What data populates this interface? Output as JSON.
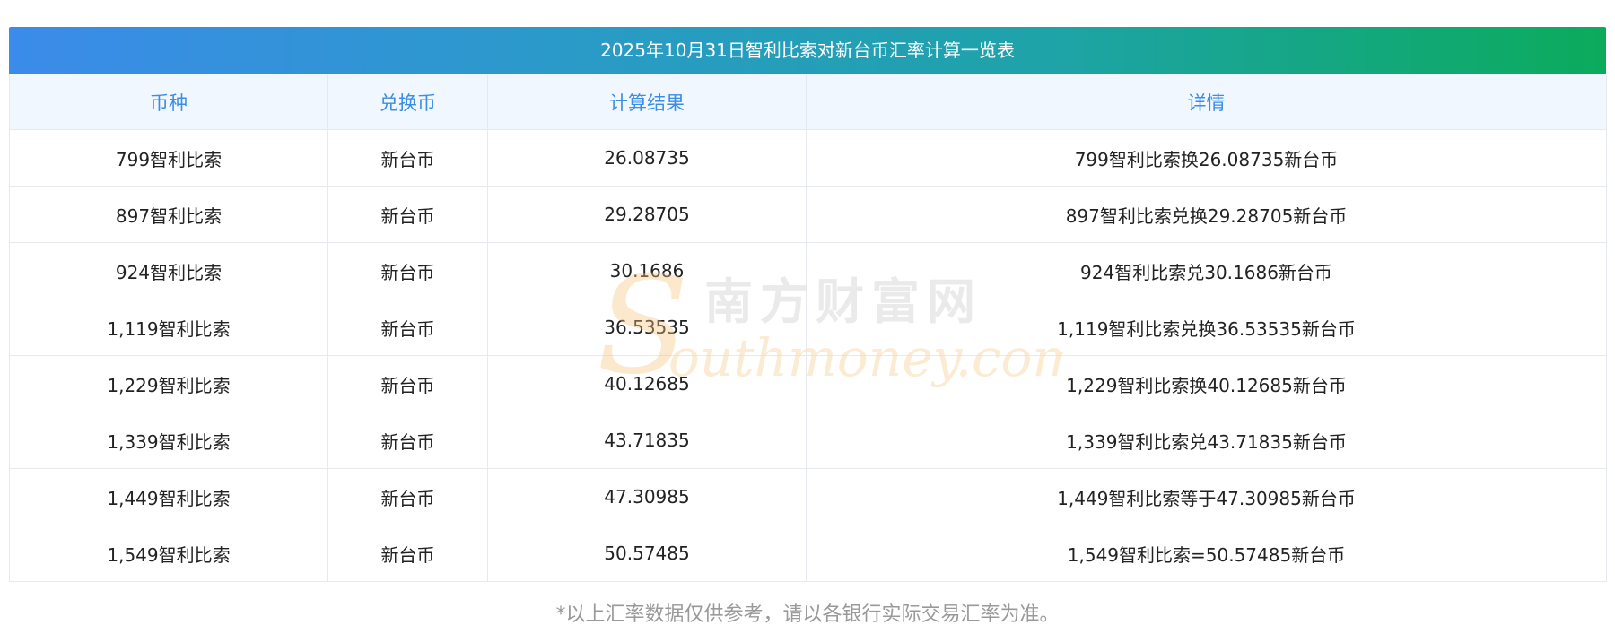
{
  "title": "2025年10月31日智利比索对新台币汇率计算一览表",
  "columns": [
    "币种",
    "兑换币",
    "计算结果",
    "详情"
  ],
  "rows": [
    {
      "currency": "799智利比索",
      "target": "新台币",
      "result": "26.08735",
      "detail": "799智利比索换26.08735新台币"
    },
    {
      "currency": "897智利比索",
      "target": "新台币",
      "result": "29.28705",
      "detail": "897智利比索兑换29.28705新台币"
    },
    {
      "currency": "924智利比索",
      "target": "新台币",
      "result": "30.1686",
      "detail": "924智利比索兑30.1686新台币"
    },
    {
      "currency": "1,119智利比索",
      "target": "新台币",
      "result": "36.53535",
      "detail": "1,119智利比索兑换36.53535新台币"
    },
    {
      "currency": "1,229智利比索",
      "target": "新台币",
      "result": "40.12685",
      "detail": "1,229智利比索换40.12685新台币"
    },
    {
      "currency": "1,339智利比索",
      "target": "新台币",
      "result": "43.71835",
      "detail": "1,339智利比索兑43.71835新台币"
    },
    {
      "currency": "1,449智利比索",
      "target": "新台币",
      "result": "47.30985",
      "detail": "1,449智利比索等于47.30985新台币"
    },
    {
      "currency": "1,549智利比索",
      "target": "新台币",
      "result": "50.57485",
      "detail": "1,549智利比索=50.57485新台币"
    }
  ],
  "watermark": {
    "cn": "南方财富网",
    "en": "outhmoney.com",
    "s": "S"
  },
  "footnote": "*以上汇率数据仅供参考，请以各银行实际交易汇率为准。",
  "colors": {
    "header_text": "#3a8ee6",
    "header_bg": "#f1f7fe",
    "gradient_start": "#3b8bea",
    "gradient_end": "#0bab5c"
  }
}
